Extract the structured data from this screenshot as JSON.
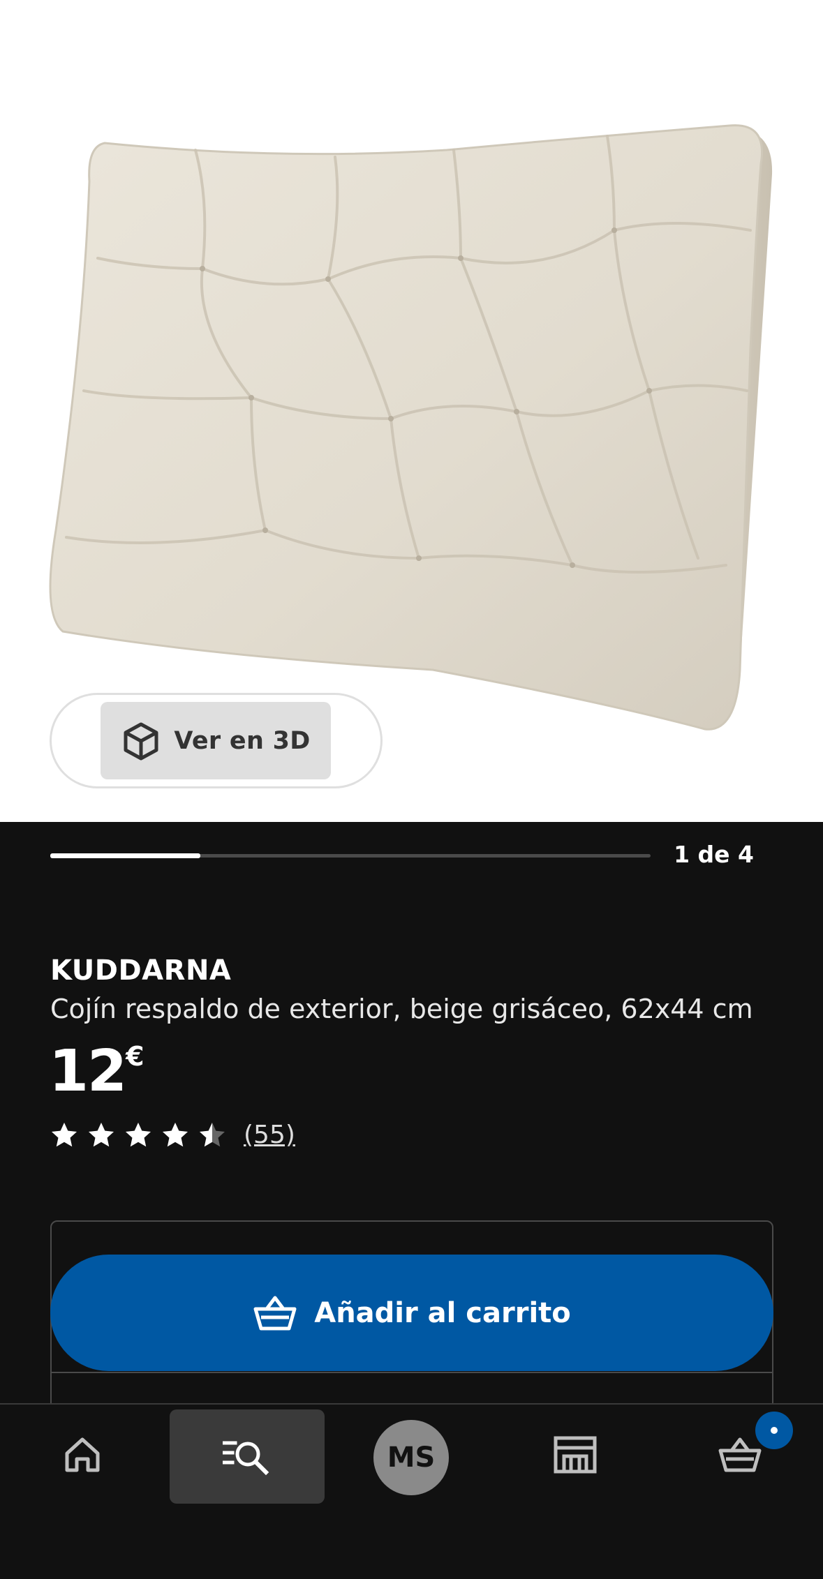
{
  "gallery": {
    "view_3d_label": "Ver en 3D",
    "page_indicator": "1 de 4",
    "progress_fraction": 0.25
  },
  "product": {
    "name": "KUDDARNA",
    "description": "Cojín respaldo de exterior, beige grisáceo, 62x44 cm",
    "price": {
      "amount": "12",
      "currency": "€"
    },
    "rating": {
      "stars": 4.5,
      "max_stars": 5,
      "review_count": "(55)"
    }
  },
  "actions": {
    "add_to_cart_label": "Añadir al carrito"
  },
  "bottom_nav": {
    "items": [
      {
        "icon": "home-icon",
        "selected": false
      },
      {
        "icon": "search-list-icon",
        "selected": true
      },
      {
        "icon": "profile-avatar",
        "initials": "MS",
        "selected": false
      },
      {
        "icon": "store-icon",
        "selected": false
      },
      {
        "icon": "cart-icon",
        "selected": false,
        "badge": true
      }
    ]
  },
  "colors": {
    "background": "#111111",
    "accent_blue": "#0058a3",
    "product_beige": "#e4ddd0",
    "nav_selected": "#3a3a3a"
  }
}
